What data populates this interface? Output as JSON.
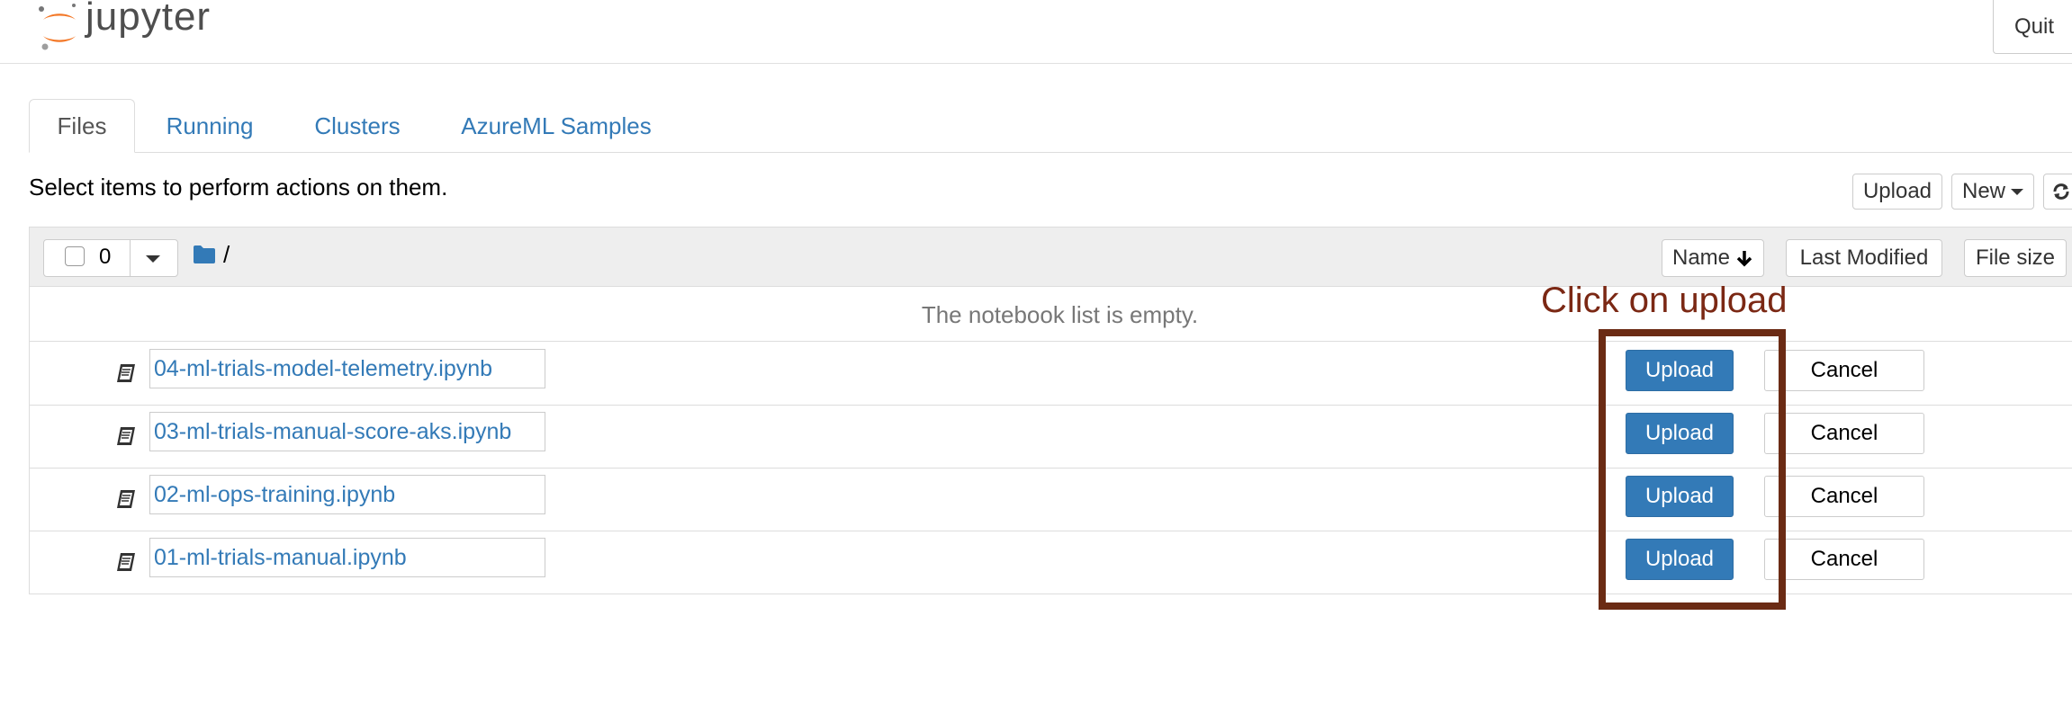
{
  "header": {
    "logo_text": "jupyter",
    "quit_label": "Quit"
  },
  "tabs": [
    {
      "label": "Files",
      "active": true
    },
    {
      "label": "Running"
    },
    {
      "label": "Clusters"
    },
    {
      "label": "AzureML Samples"
    }
  ],
  "helper_text": "Select items to perform actions on them.",
  "toolbar": {
    "upload_label": "Upload",
    "new_label": "New"
  },
  "list_header": {
    "selected_count": "0",
    "path": "/",
    "sort_name": "Name",
    "sort_modified": "Last Modified",
    "sort_size": "File size"
  },
  "empty_message": "The notebook list is empty.",
  "files": [
    {
      "name": "04-ml-trials-model-telemetry.ipynb",
      "upload_label": "Upload",
      "cancel_label": "Cancel"
    },
    {
      "name": "03-ml-trials-manual-score-aks.ipynb",
      "upload_label": "Upload",
      "cancel_label": "Cancel"
    },
    {
      "name": "02-ml-ops-training.ipynb",
      "upload_label": "Upload",
      "cancel_label": "Cancel"
    },
    {
      "name": "01-ml-trials-manual.ipynb",
      "upload_label": "Upload",
      "cancel_label": "Cancel"
    }
  ],
  "annotation": {
    "text": "Click on upload",
    "color": "#7b2814"
  },
  "colors": {
    "link": "#337ab7",
    "primary_button": "#337ab7",
    "logo_orange": "#f37726"
  }
}
